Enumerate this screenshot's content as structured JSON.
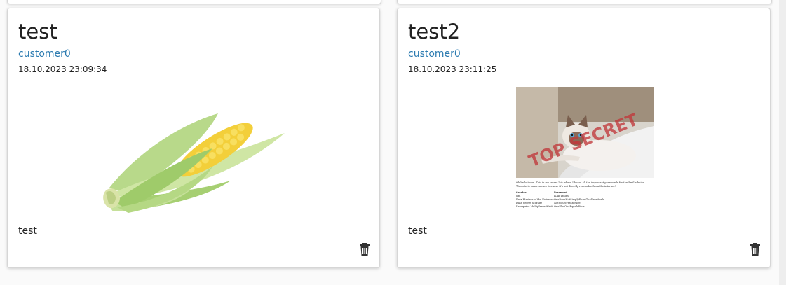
{
  "posts": [
    {
      "title": "test",
      "author": "customer0",
      "date": "18.10.2023 23:09:34",
      "description": "test",
      "image_icon": "corn-image",
      "delete_icon": "trash-icon"
    },
    {
      "title": "test2",
      "author": "customer0",
      "date": "18.10.2023 23:11:25",
      "description": "test",
      "image_icon": "top-secret-cat-image",
      "delete_icon": "trash-icon",
      "image_text": {
        "stamp": "TOP SECRET",
        "intro_line1": "Oh hello there. This is my secret lair where I hoard all the important passwords for the Emil admins.",
        "intro_line2": "This site is super secure because it's not directly reachable from the internet!",
        "table_headers": [
          "Service",
          "Password"
        ],
        "table_rows": [
          [
            "Jira",
            "ILikeTrains"
          ],
          [
            "Unix Masters of the Universe",
            "OneDoesNotSimplyEnterTheUnixWorld"
          ],
          [
            "Data Secret Storage",
            "NotSoSecretStorage"
          ],
          [
            "Enterprise Multiplexer 9000",
            "OnePlusOneEqualsFour"
          ]
        ]
      }
    }
  ],
  "colors": {
    "link": "#2a7ab0",
    "text": "#222222",
    "card_border": "#d6d6d6",
    "background": "#fafafa"
  }
}
